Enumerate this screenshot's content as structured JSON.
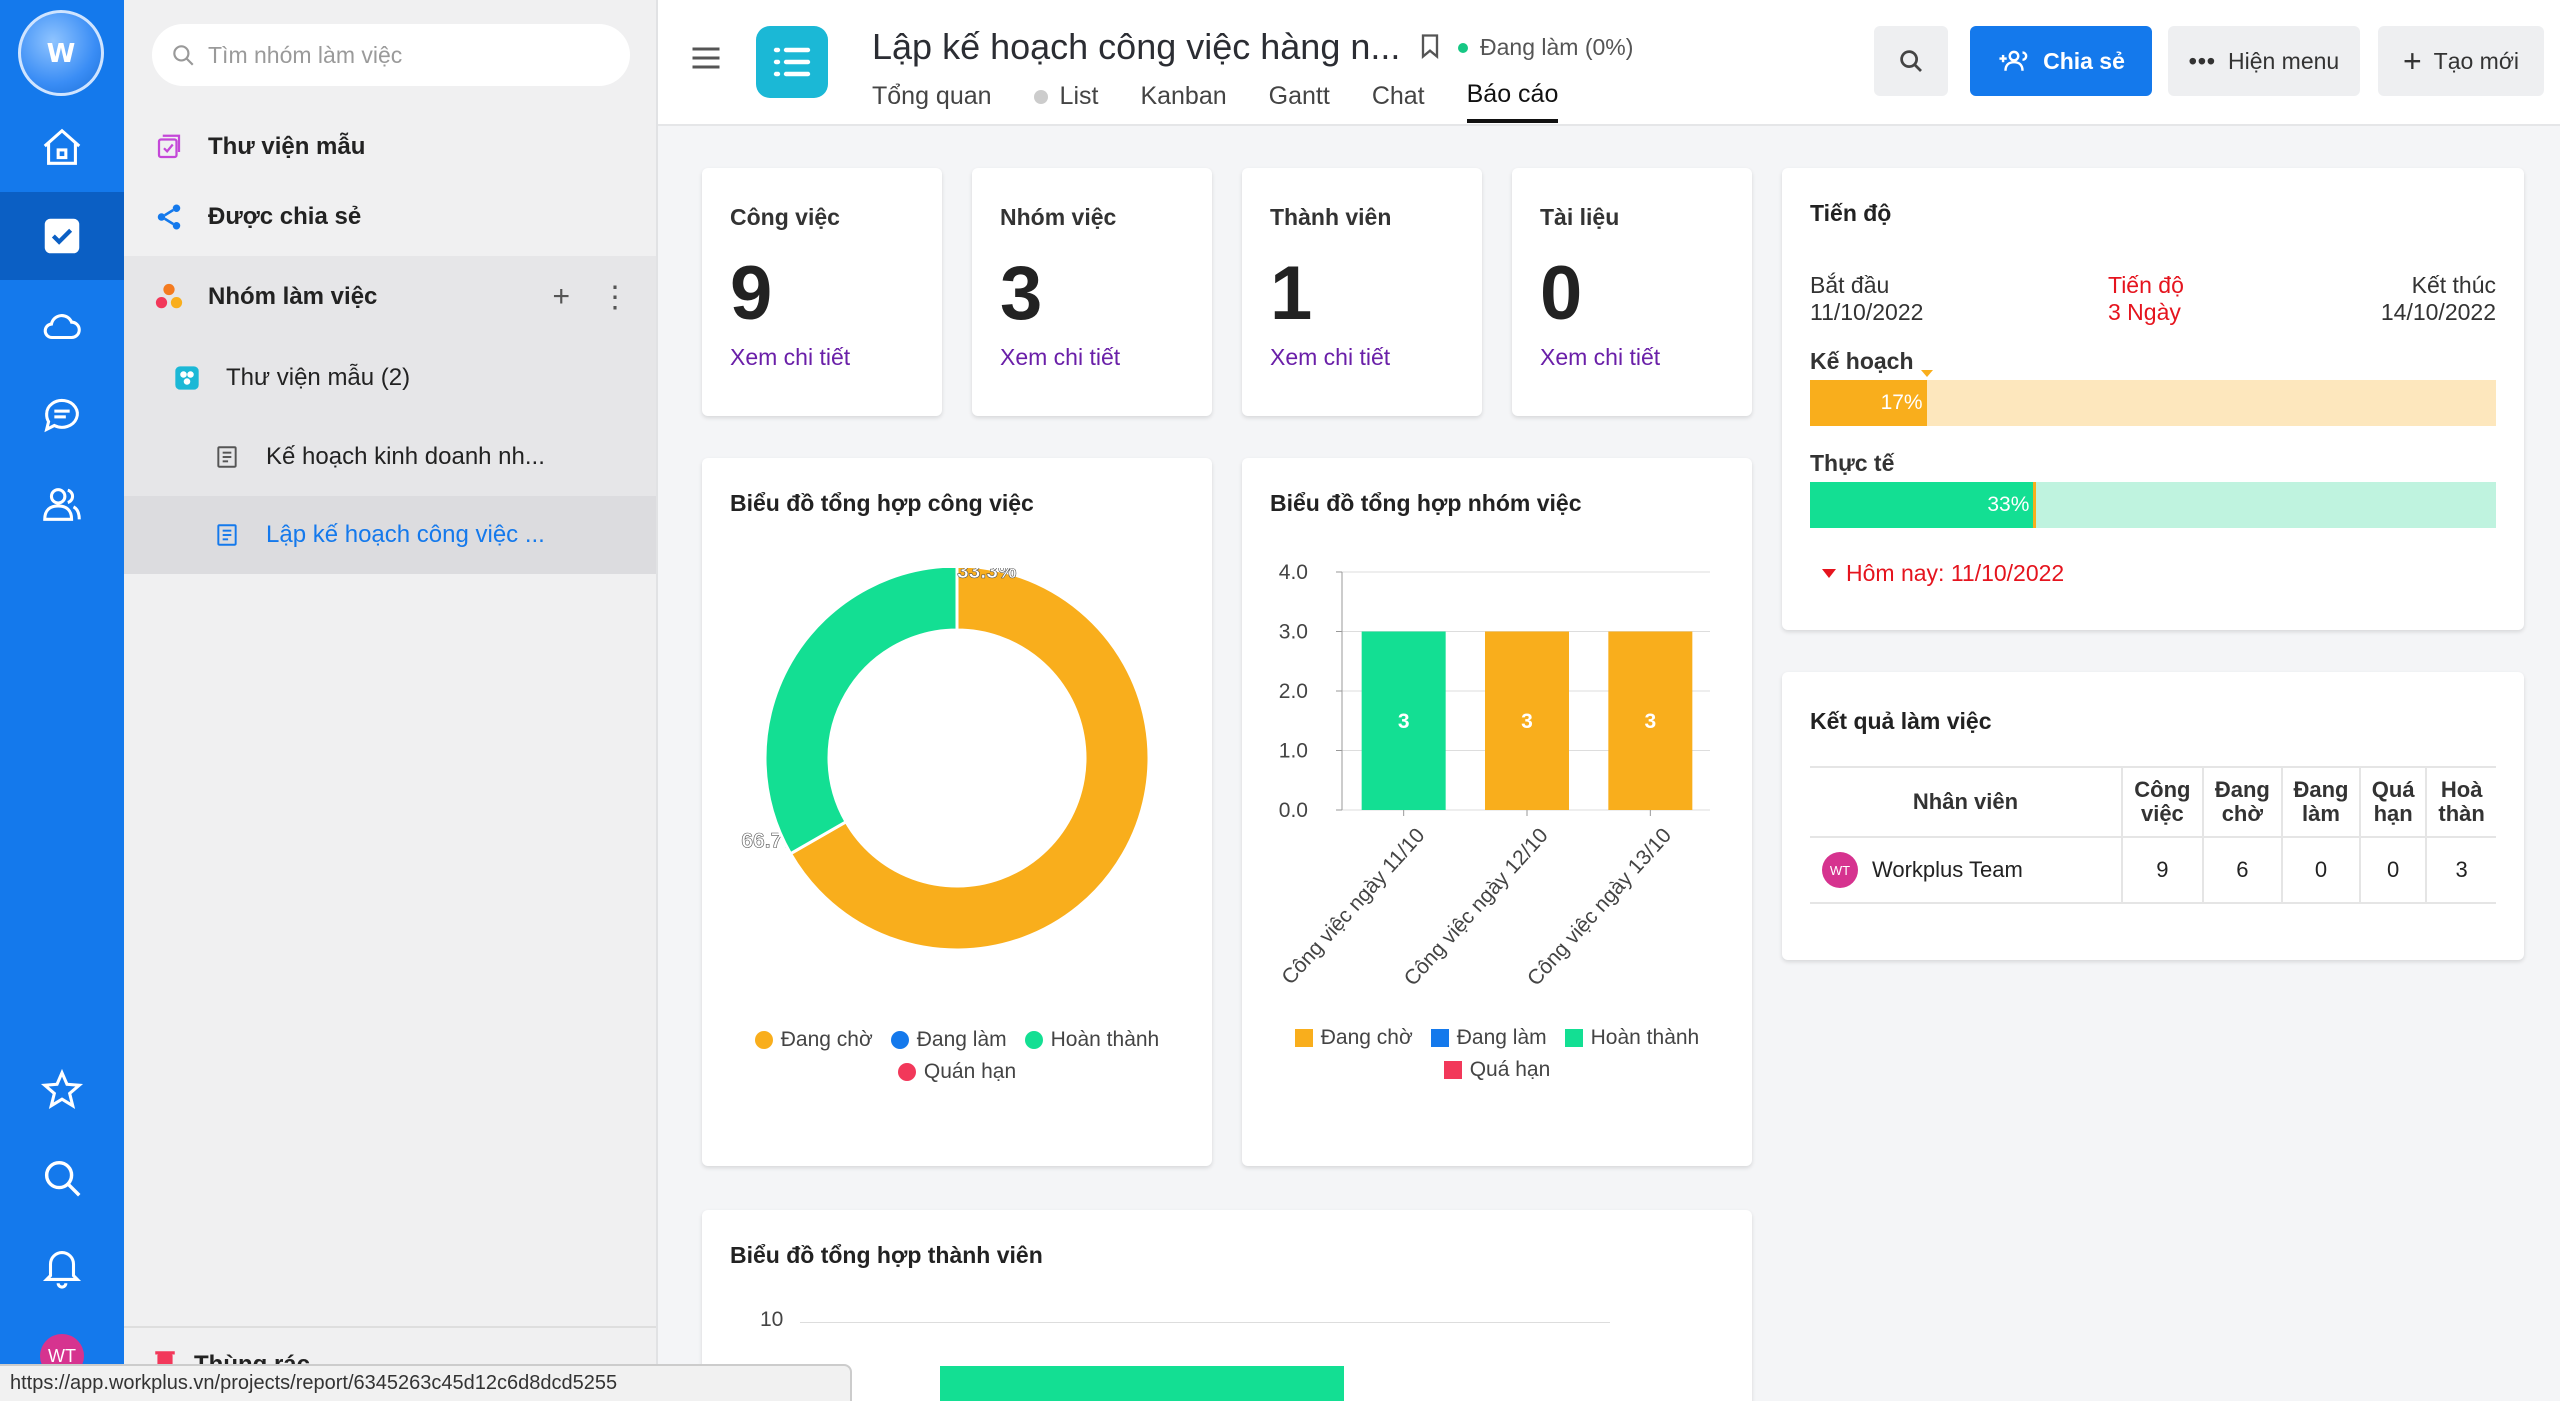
{
  "rail": {
    "logo_text": "W",
    "avatar": "WT"
  },
  "sidebar": {
    "search_placeholder": "Tìm nhóm làm việc",
    "library": "Thư viện mẫu",
    "shared": "Được chia sẻ",
    "group": "Nhóm làm việc",
    "folder": "Thư viện mẫu  (2)",
    "docs": [
      "Kế hoạch kinh doanh nh...",
      "Lập kế hoạch công việc ..."
    ],
    "trash": "Thùng rác"
  },
  "topbar": {
    "title": "Lập kế hoạch công việc hàng n...",
    "status": "Đang làm (0%)",
    "tabs": [
      "Tổng quan",
      "List",
      "Kanban",
      "Gantt",
      "Chat",
      "Báo cáo"
    ],
    "share": "Chia sẻ",
    "show_menu": "Hiện menu",
    "create": "Tạo mới"
  },
  "stats": [
    {
      "label": "Công việc",
      "value": "9",
      "link": "Xem chi tiết"
    },
    {
      "label": "Nhóm việc",
      "value": "3",
      "link": "Xem chi tiết"
    },
    {
      "label": "Thành viên",
      "value": "1",
      "link": "Xem chi tiết"
    },
    {
      "label": "Tài liệu",
      "value": "0",
      "link": "Xem chi tiết"
    }
  ],
  "progress": {
    "title": "Tiến độ",
    "start_label": "Bắt đầu",
    "start": "11/10/2022",
    "mid_label": "Tiến độ",
    "mid": "3 Ngày",
    "end_label": "Kết thúc",
    "end": "14/10/2022",
    "plan_label": "Kế hoạch",
    "plan_pct": 17,
    "plan_text": "17%",
    "actual_label": "Thực tế",
    "actual_pct": 33,
    "actual_text": "33%",
    "today": "Hôm nay: 11/10/2022"
  },
  "results": {
    "title": "Kết quả làm việc",
    "headers": [
      "Nhân viên",
      "Công việc",
      "Đang chờ",
      "Đang làm",
      "Quá hạn",
      "Hoà thàn"
    ],
    "rows": [
      {
        "avatar": "WT",
        "name": "Workplus Team",
        "values": [
          "9",
          "6",
          "0",
          "0",
          "3"
        ]
      }
    ]
  },
  "colors": {
    "waiting": "#f9ae1c",
    "doing": "#1479ec",
    "done": "#13df93",
    "overdue": "#f2385a"
  },
  "chart_titles": {
    "tasks": "Biểu đồ tổng hợp công việc",
    "groups": "Biểu đồ tổng hợp nhóm việc",
    "members": "Biểu đồ tổng hợp thành viên"
  },
  "legend_tasks": [
    "Đang chờ",
    "Đang làm",
    "Hoàn thành",
    "Quán hạn"
  ],
  "legend_groups": [
    "Đang chờ",
    "Đang làm",
    "Hoàn thành",
    "Quá hạn"
  ],
  "chart_data": [
    {
      "type": "pie",
      "title": "Biểu đồ tổng hợp công việc",
      "categories": [
        "Đang chờ",
        "Đang làm",
        "Hoàn thành",
        "Quán hạn"
      ],
      "values": [
        66.7,
        0,
        33.3,
        0
      ],
      "labels": [
        "66.7%",
        "",
        "33.3%",
        ""
      ]
    },
    {
      "type": "bar",
      "title": "Biểu đồ tổng hợp nhóm việc",
      "categories": [
        "Công việc ngày 11/10",
        "Công việc ngày 12/10",
        "Công việc ngày 13/10"
      ],
      "series": [
        {
          "name": "Đang chờ",
          "values": [
            0,
            3,
            3
          ]
        },
        {
          "name": "Đang làm",
          "values": [
            0,
            0,
            0
          ]
        },
        {
          "name": "Hoàn thành",
          "values": [
            3,
            0,
            0
          ]
        },
        {
          "name": "Quá hạn",
          "values": [
            0,
            0,
            0
          ]
        }
      ],
      "data_labels": [
        "3",
        "3",
        "3"
      ],
      "yticks": [
        "0.0",
        "1.0",
        "2.0",
        "3.0",
        "4.0"
      ],
      "ylim": [
        0,
        4
      ]
    },
    {
      "type": "bar",
      "title": "Biểu đồ tổng hợp thành viên",
      "yticks": [
        "10"
      ]
    }
  ],
  "status_url": "https://app.workplus.vn/projects/report/6345263c45d12c6d8dcd5255"
}
